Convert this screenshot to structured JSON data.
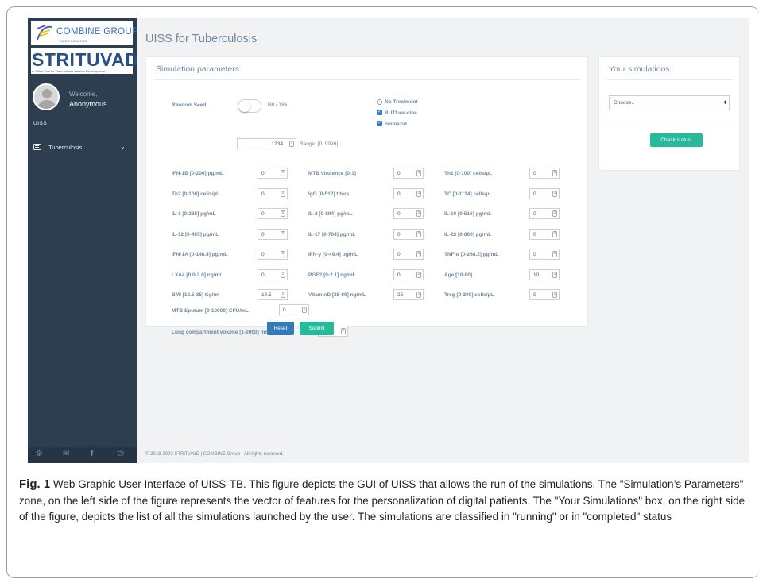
{
  "app": {
    "logo_top": "COMBINE GROUP",
    "logo_top_sub": "BIOINFORMATICS",
    "logo_main": "STRITUVAD",
    "logo_main_sub": "In Silico Trial for Tuberculosis Vaccine Development",
    "page_title": "UISS for Tuberculosis"
  },
  "user": {
    "welcome": "Welcome,",
    "name": "Anonymous"
  },
  "sidebar": {
    "section": "UISS",
    "menu": [
      {
        "label": "Tuberculosis",
        "icon": "list-icon",
        "chevron": "⌄"
      }
    ],
    "footer_icons": [
      "settings-icon",
      "mail-icon",
      "facebook-icon",
      "power-icon"
    ]
  },
  "simulation": {
    "title": "Simulation parameters",
    "random_seed": {
      "label": "Random Seed",
      "toggle_text": "No / Yes",
      "value": "1234",
      "range": "Range: [0, 9999]"
    },
    "treatments": [
      {
        "label": "No Treatment",
        "checked": false
      },
      {
        "label": "RUTI vaccine",
        "checked": true
      },
      {
        "label": "Isoniazid",
        "checked": true
      }
    ],
    "params": [
      {
        "label": "IFN-1B [0-206] pg/mL",
        "value": "0"
      },
      {
        "label": "MTB virulence [0-1]",
        "value": "0"
      },
      {
        "label": "Th1 [0-100] cells/µL",
        "value": "0"
      },
      {
        "label": "Th2 [0-100] cells/µL",
        "value": "0"
      },
      {
        "label": "IgG [0-512] titers",
        "value": "0"
      },
      {
        "label": "TC [0-1134] cells/µL",
        "value": "0"
      },
      {
        "label": "IL-1 [0-235] pg/mL",
        "value": "0"
      },
      {
        "label": "IL-2 [0-894] pg/mL",
        "value": "0"
      },
      {
        "label": "IL-10 [0-516] pg/mL",
        "value": "0"
      },
      {
        "label": "IL-12 [0-495] pg/mL",
        "value": "0"
      },
      {
        "label": "IL-17 [0-704] pg/mL",
        "value": "0"
      },
      {
        "label": "IL-23 [0-800] pg/mL",
        "value": "0"
      },
      {
        "label": "IFN-1A [0-148.4] pg/mL",
        "value": "0"
      },
      {
        "label": "IFN-γ [0-49.4] pg/mL",
        "value": "0"
      },
      {
        "label": "TNF-α [0-268.2] pg/mL",
        "value": "0"
      },
      {
        "label": "LXA4 [0.0-3.0] ng/mL",
        "value": "0"
      },
      {
        "label": "PGE2 [0-2.1] ng/mL",
        "value": "0"
      },
      {
        "label": "Age [10-80]",
        "value": "10"
      },
      {
        "label": "BMI [18.5-35] Kg/m²",
        "value": "18.5"
      },
      {
        "label": "VitaminD [25-80] ng/mL",
        "value": "25"
      },
      {
        "label": "Treg [0-200] cells/µL",
        "value": "0"
      }
    ],
    "sputum": {
      "label": "MTB Sputum [0-10000] CFU/mL",
      "value": "0"
    },
    "lung": {
      "label": "Lung compartment volume [1-2000] mm³",
      "value": "1"
    },
    "reset_label": "Reset",
    "submit_label": "Submit"
  },
  "your_simulations": {
    "title": "Your simulations",
    "select_value": "Choose..",
    "check_label": "Check status!"
  },
  "footer": "© 2018-2023 STRiTuVaD | COMBINE Group - All rights reserved.",
  "caption": {
    "fig": "Fig. 1",
    "text": " Web Graphic User Interface of UISS-TB. This figure depicts the GUI of UISS that allows the run of the simulations. The \"Simulation’s Parameters\" zone, on the left side of the figure represents the vector of features for the personalization of digital patients. The \"Your Simulations\" box, on the right side of the figure, depicts the list of all the simulations launched by the user. The simulations are classified in \"running\" or in \"completed\" status"
  },
  "colors": {
    "sidebar": "#2c3e50",
    "primary": "#337ab7",
    "success": "#26b99a",
    "text_muted": "#73879c"
  }
}
